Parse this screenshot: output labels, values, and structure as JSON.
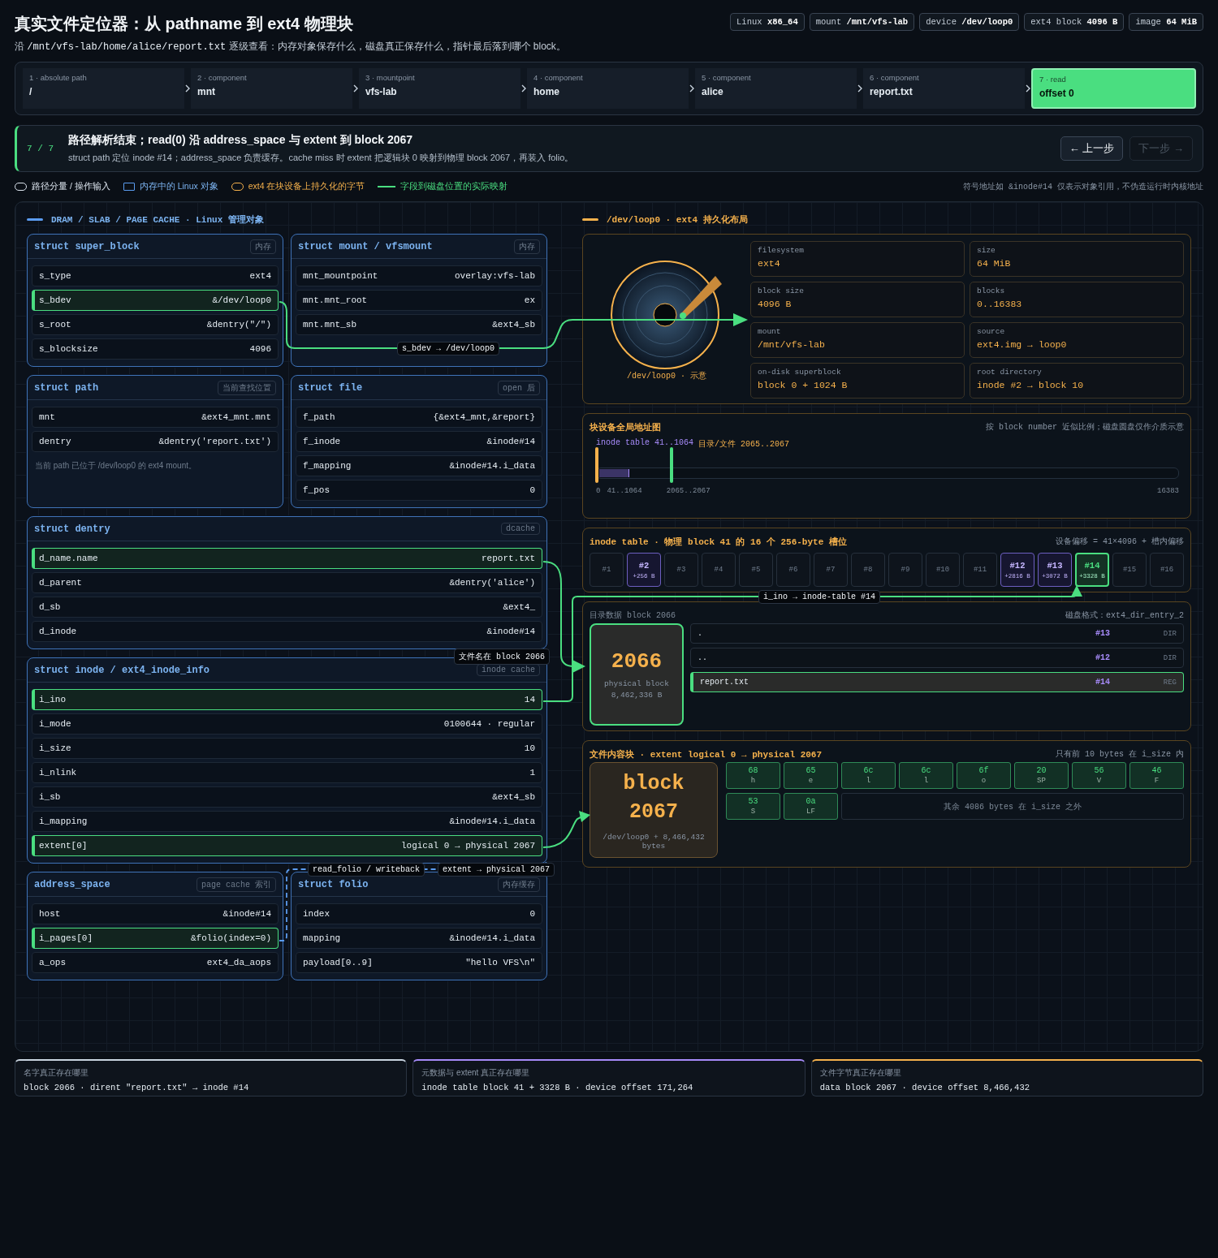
{
  "header": {
    "title": "真实文件定位器：从 pathname 到 ext4 物理块",
    "prefix": "沿",
    "path": "/mnt/vfs-lab/home/alice/report.txt",
    "rest": "逐级查看：内存对象保存什么，磁盘真正保存什么，指针最后落到哪个 block。"
  },
  "chips": [
    {
      "label": "Linux",
      "value": "x86_64"
    },
    {
      "label": "mount",
      "value": "/mnt/vfs-lab"
    },
    {
      "label": "device",
      "value": "/dev/loop0"
    },
    {
      "label": "ext4 block",
      "value": "4096 B"
    },
    {
      "label": "image",
      "value": "64 MiB"
    }
  ],
  "steps": [
    {
      "label": "1 · absolute path",
      "value": "/",
      "selected": false
    },
    {
      "label": "2 · component",
      "value": "mnt",
      "selected": false
    },
    {
      "label": "3 · mountpoint",
      "value": "vfs-lab",
      "selected": false
    },
    {
      "label": "4 · component",
      "value": "home",
      "selected": false
    },
    {
      "label": "5 · component",
      "value": "alice",
      "selected": false
    },
    {
      "label": "6 · component",
      "value": "report.txt",
      "selected": false
    },
    {
      "label": "7 · read",
      "value": "offset 0",
      "selected": true
    }
  ],
  "step_card": {
    "counter": "7 / 7",
    "title": "路径解析结束；read(0) 沿 address_space 与 extent 到 block 2067",
    "text": "struct path 定位 inode #14；address_space 负责缓存。cache miss 时 extent 把逻辑块 0 映射到物理 block 2067，再装入 folio。",
    "buttons": [
      {
        "label": "← 上一步",
        "disabled": false
      },
      {
        "label": "下一步 →",
        "disabled": true
      }
    ]
  },
  "legend": {
    "items": [
      {
        "kind": "path",
        "label": "路径分量 / 操作输入"
      },
      {
        "kind": "memory",
        "label": "内存中的 Linux 对象"
      },
      {
        "kind": "disk",
        "label": "ext4 在块设备上持久化的字节"
      },
      {
        "kind": "mapping",
        "label": "字段到磁盘位置的实际映射"
      }
    ],
    "note": "符号地址如 &inode#14 仅表示对象引用，不伪造运行时内核地址"
  },
  "memory": {
    "title": "DRAM / SLAB / PAGE CACHE · Linux 管理对象",
    "structs": [
      {
        "kind": "half",
        "title": "struct super_block",
        "tag": "内存",
        "fields": [
          {
            "name": "s_type",
            "value": "ext4",
            "linked": false
          },
          {
            "name": "s_bdev",
            "value": "&/dev/loop0",
            "linked": true
          },
          {
            "name": "s_root",
            "value": "&dentry(\"/\")",
            "linked": false
          },
          {
            "name": "s_blocksize",
            "value": "4096",
            "linked": false
          }
        ]
      },
      {
        "kind": "half",
        "title": "struct mount / vfsmount",
        "tag": "内存",
        "fields": [
          {
            "name": "mnt_mountpoint",
            "value": "overlay:vfs-lab",
            "linked": false
          },
          {
            "name": "mnt.mnt_root",
            "value": "ex",
            "linked": false
          },
          {
            "name": "mnt.mnt_sb",
            "value": "&ext4_sb",
            "linked": false
          }
        ]
      },
      {
        "kind": "half",
        "title": "struct path",
        "tag": "当前查找位置",
        "fields": [
          {
            "name": "mnt",
            "value": "&ext4_mnt.mnt",
            "linked": false
          },
          {
            "name": "dentry",
            "value": "&dentry('report.txt')",
            "linked": false
          }
        ],
        "note": "当前 path 已位于 /dev/loop0 的 ext4 mount。"
      },
      {
        "kind": "half",
        "title": "struct file",
        "tag": "open 后",
        "fields": [
          {
            "name": "f_path",
            "value": "{&ext4_mnt,&report}",
            "linked": false
          },
          {
            "name": "f_inode",
            "value": "&inode#14",
            "linked": false
          },
          {
            "name": "f_mapping",
            "value": "&inode#14.i_data",
            "linked": false
          },
          {
            "name": "f_pos",
            "value": "0",
            "linked": false
          }
        ]
      },
      {
        "kind": "wide",
        "title": "struct dentry",
        "tag": "dcache",
        "fields": [
          {
            "name": "d_name.name",
            "value": "report.txt",
            "linked": true
          },
          {
            "name": "d_parent",
            "value": "&dentry('alice')",
            "linked": false
          },
          {
            "name": "d_sb",
            "value": "&ext4_",
            "linked": false
          },
          {
            "name": "d_inode",
            "value": "&inode#14",
            "linked": false
          }
        ]
      },
      {
        "kind": "wide",
        "title": "struct inode / ext4_inode_info",
        "tag": "inode cache",
        "fields": [
          {
            "name": "i_ino",
            "value": "14",
            "linked": true
          },
          {
            "name": "i_mode",
            "value": "0100644 · regular",
            "linked": false
          },
          {
            "name": "i_size",
            "value": "10",
            "linked": false
          },
          {
            "name": "i_nlink",
            "value": "1",
            "linked": false
          },
          {
            "name": "i_sb",
            "value": "&ext4_sb",
            "linked": false
          },
          {
            "name": "i_mapping",
            "value": "&inode#14.i_data",
            "linked": false
          },
          {
            "name": "extent[0]",
            "value": "logical 0 → physical 2067",
            "linked": true
          }
        ]
      },
      {
        "kind": "half",
        "title": "address_space",
        "tag": "page cache 索引",
        "fields": [
          {
            "name": "host",
            "value": "&inode#14",
            "linked": false
          },
          {
            "name": "i_pages[0]",
            "value": "&folio(index=0)",
            "linked": true
          },
          {
            "name": "a_ops",
            "value": "ext4_da_aops",
            "linked": false
          }
        ]
      },
      {
        "kind": "half",
        "title": "struct folio",
        "tag": "内存缓存",
        "fields": [
          {
            "name": "index",
            "value": "0",
            "linked": false
          },
          {
            "name": "mapping",
            "value": "&inode#14.i_data",
            "linked": false
          },
          {
            "name": "payload[0..9]",
            "value": "\"hello VFS\\n\"",
            "linked": false
          }
        ]
      }
    ]
  },
  "disk": {
    "title": "/dev/loop0 · ext4 持久化布局",
    "caption": "/dev/loop0 · 示意",
    "facts": [
      {
        "label": "filesystem",
        "value": "ext4"
      },
      {
        "label": "size",
        "value": "64 MiB"
      },
      {
        "label": "block size",
        "value": "4096 B"
      },
      {
        "label": "blocks",
        "value": "0..16383"
      },
      {
        "label": "mount",
        "value": "/mnt/vfs-lab"
      },
      {
        "label": "source",
        "value": "ext4.img → loop0"
      },
      {
        "label": "on-disk superblock",
        "value": "block 0 + 1024 B"
      },
      {
        "label": "root directory",
        "value": "inode #2 → block 10"
      }
    ],
    "block_map": {
      "title": "块设备全局地址图",
      "note": "按 block number 近似比例；磁盘圆盘仅作介质示意",
      "labels": [
        "inode table 41..1064",
        "目录/文件 2065..2067"
      ],
      "level": 0.05,
      "ticks": [
        "0",
        "41..1064",
        "2065..2067",
        "16383"
      ]
    },
    "inode_table": {
      "title": "inode table · 物理 block 41 的 16 个 256-byte 槽位",
      "note": "设备偏移 = 41×4096 + 槽内偏移",
      "slots": [
        {
          "label": "#1",
          "kind": "empty"
        },
        {
          "label": "#2",
          "offset": "+256 B",
          "kind": "used"
        },
        {
          "label": "#3",
          "kind": "empty"
        },
        {
          "label": "#4",
          "kind": "empty"
        },
        {
          "label": "#5",
          "kind": "empty"
        },
        {
          "label": "#6",
          "kind": "empty"
        },
        {
          "label": "#7",
          "kind": "empty"
        },
        {
          "label": "#8",
          "kind": "empty"
        },
        {
          "label": "#9",
          "kind": "empty"
        },
        {
          "label": "#10",
          "kind": "empty"
        },
        {
          "label": "#11",
          "kind": "empty"
        },
        {
          "label": "#12",
          "offset": "+2816 B",
          "kind": "used"
        },
        {
          "label": "#13",
          "offset": "+3072 B",
          "kind": "used"
        },
        {
          "label": "#14",
          "offset": "+3328 B",
          "kind": "target"
        },
        {
          "label": "#15",
          "kind": "empty"
        },
        {
          "label": "#16",
          "kind": "empty"
        }
      ]
    },
    "dir_block": {
      "title": "目录数据 block 2066",
      "note": "磁盘格式：ext4_dir_entry_2",
      "number": "2066",
      "caption": "physical block",
      "offset": "8,462,336 B",
      "entries": [
        {
          "name": ".",
          "inode": "#13",
          "type": "DIR",
          "selected": false
        },
        {
          "name": "..",
          "inode": "#12",
          "type": "DIR",
          "selected": false
        },
        {
          "name": "report.txt",
          "inode": "#14",
          "type": "REG",
          "selected": true
        }
      ]
    },
    "file_block": {
      "title": "文件内容块 · extent logical 0 → physical 2067",
      "note": "只有前 10 bytes 在 i_size 内",
      "word": "block",
      "number": "2067",
      "caption": "/dev/loop0 + 8,466,432 bytes",
      "bytes": [
        {
          "hex": "68",
          "char": "h"
        },
        {
          "hex": "65",
          "char": "e"
        },
        {
          "hex": "6c",
          "char": "l"
        },
        {
          "hex": "6c",
          "char": "l"
        },
        {
          "hex": "6f",
          "char": "o"
        },
        {
          "hex": "20",
          "char": "SP"
        },
        {
          "hex": "56",
          "char": "V"
        },
        {
          "hex": "46",
          "char": "F"
        },
        {
          "hex": "53",
          "char": "S"
        },
        {
          "hex": "0a",
          "char": "LF"
        }
      ],
      "rest": "其余 4086 bytes 在 i_size 之外"
    }
  },
  "connectors": [
    {
      "label": "s_bdev → /dev/loop0",
      "kind": "solid"
    },
    {
      "label": "文件名在 block 2066",
      "kind": "solid"
    },
    {
      "label": "i_ino → inode-table #14",
      "kind": "solid"
    },
    {
      "label": "read_folio / writeback",
      "kind": "dashed"
    },
    {
      "label": "extent → physical 2067",
      "kind": "solid"
    }
  ],
  "footer": [
    {
      "label": "名字真正存在哪里",
      "value": "block 2066 · dirent \"report.txt\" → inode #14",
      "color": "#c9d4e0"
    },
    {
      "label": "元数据与 extent 真正存在哪里",
      "value": "inode table block 41 + 3328 B · device offset 171,264",
      "color": "#a78bfa"
    },
    {
      "label": "文件字节真正存在哪里",
      "value": "data block 2067 · device offset 8,466,432",
      "color": "#f5b14c"
    }
  ]
}
